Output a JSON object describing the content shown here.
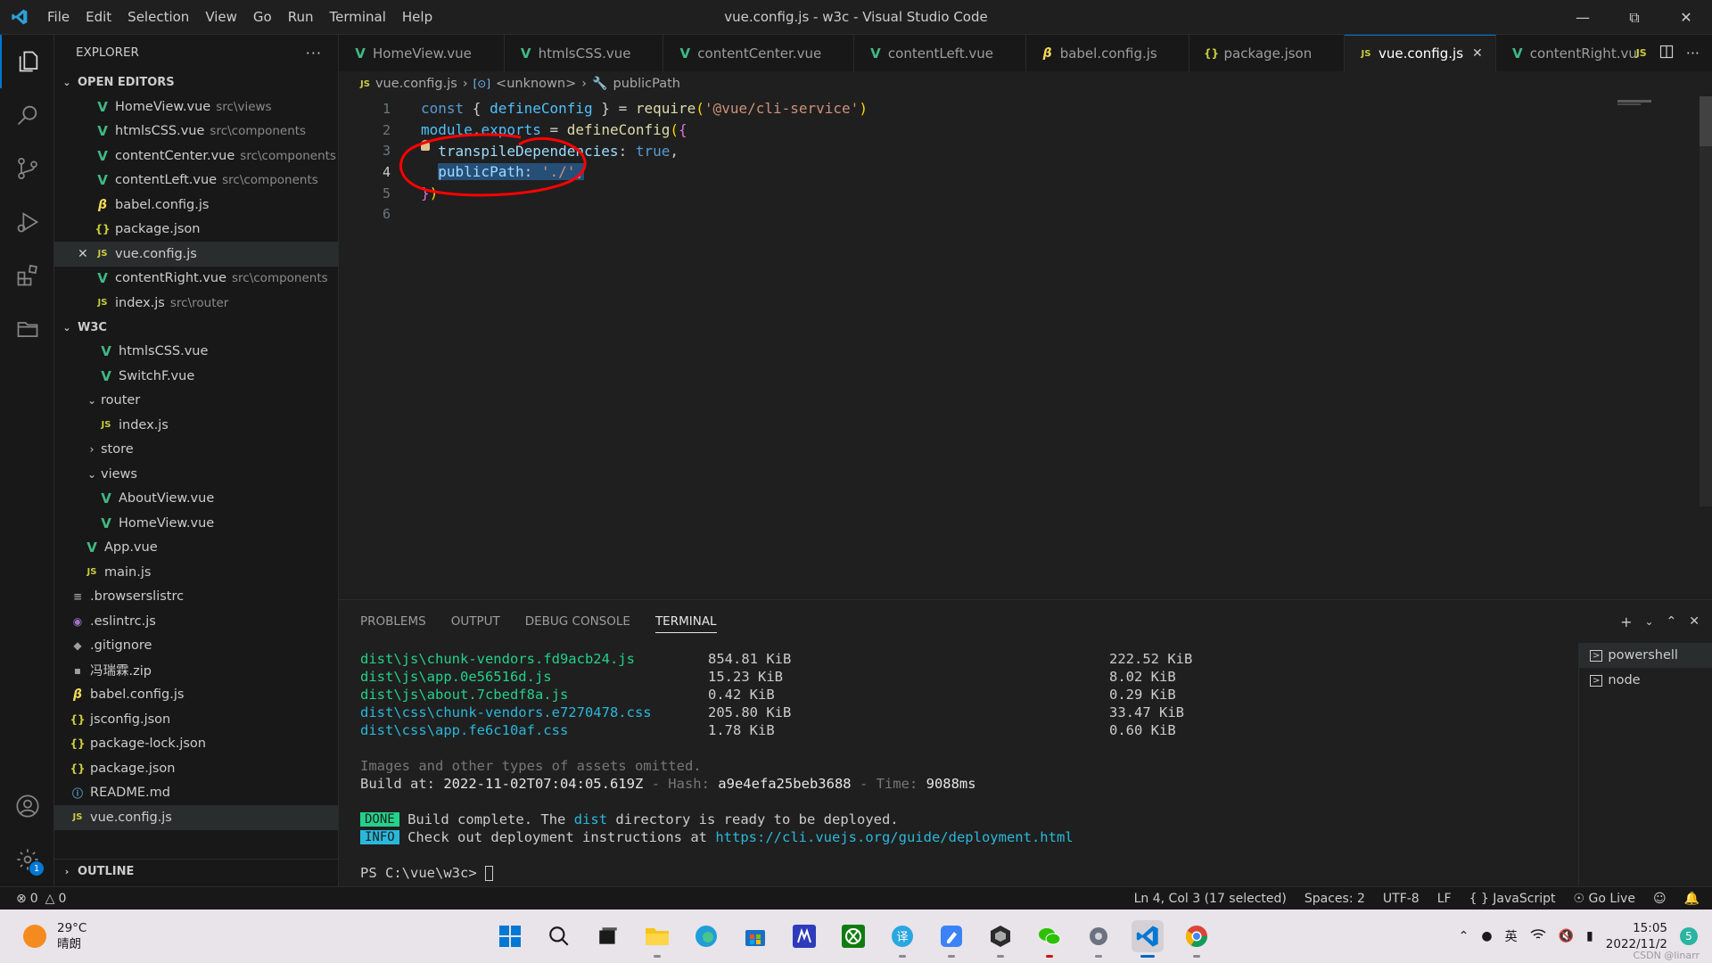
{
  "window": {
    "title": "vue.config.js - w3c - Visual Studio Code"
  },
  "menu": [
    "File",
    "Edit",
    "Selection",
    "View",
    "Go",
    "Run",
    "Terminal",
    "Help"
  ],
  "sidebar": {
    "title": "EXPLORER",
    "open_editors_label": "OPEN EDITORS",
    "open_editors": [
      {
        "name": "HomeView.vue",
        "desc": "src\\views",
        "icon": "vue"
      },
      {
        "name": "htmlsCSS.vue",
        "desc": "src\\components",
        "icon": "vue"
      },
      {
        "name": "contentCenter.vue",
        "desc": "src\\components",
        "icon": "vue"
      },
      {
        "name": "contentLeft.vue",
        "desc": "src\\components",
        "icon": "vue"
      },
      {
        "name": "babel.config.js",
        "desc": "",
        "icon": "babel"
      },
      {
        "name": "package.json",
        "desc": "",
        "icon": "json"
      },
      {
        "name": "vue.config.js",
        "desc": "",
        "icon": "js"
      },
      {
        "name": "contentRight.vue",
        "desc": "src\\components",
        "icon": "vue"
      },
      {
        "name": "index.js",
        "desc": "src\\router",
        "icon": "js"
      }
    ],
    "project_label": "W3C",
    "tree": [
      {
        "name": "htmlsCSS.vue",
        "icon": "vue",
        "indent": 2
      },
      {
        "name": "SwitchF.vue",
        "icon": "vue",
        "indent": 2
      },
      {
        "name": "router",
        "icon": "folder-open",
        "indent": 1
      },
      {
        "name": "index.js",
        "icon": "js",
        "indent": 2
      },
      {
        "name": "store",
        "icon": "folder-closed",
        "indent": 1
      },
      {
        "name": "views",
        "icon": "folder-open",
        "indent": 1
      },
      {
        "name": "AboutView.vue",
        "icon": "vue",
        "indent": 2
      },
      {
        "name": "HomeView.vue",
        "icon": "vue",
        "indent": 2
      },
      {
        "name": "App.vue",
        "icon": "vue",
        "indent": 1
      },
      {
        "name": "main.js",
        "icon": "js",
        "indent": 1
      },
      {
        "name": ".browserslistrc",
        "icon": "list",
        "indent": 0
      },
      {
        "name": ".eslintrc.js",
        "icon": "eslint",
        "indent": 0
      },
      {
        "name": ".gitignore",
        "icon": "git",
        "indent": 0
      },
      {
        "name": "冯瑞霖.zip",
        "icon": "zip",
        "indent": 0
      },
      {
        "name": "babel.config.js",
        "icon": "babel",
        "indent": 0
      },
      {
        "name": "jsconfig.json",
        "icon": "json",
        "indent": 0
      },
      {
        "name": "package-lock.json",
        "icon": "json",
        "indent": 0
      },
      {
        "name": "package.json",
        "icon": "json",
        "indent": 0
      },
      {
        "name": "README.md",
        "icon": "info",
        "indent": 0
      },
      {
        "name": "vue.config.js",
        "icon": "js",
        "indent": 0
      }
    ],
    "outline_label": "OUTLINE"
  },
  "tabs": [
    {
      "label": "HomeView.vue",
      "icon": "vue"
    },
    {
      "label": "htmlsCSS.vue",
      "icon": "vue"
    },
    {
      "label": "contentCenter.vue",
      "icon": "vue"
    },
    {
      "label": "contentLeft.vue",
      "icon": "vue"
    },
    {
      "label": "babel.config.js",
      "icon": "babel"
    },
    {
      "label": "package.json",
      "icon": "json"
    },
    {
      "label": "vue.config.js",
      "icon": "js",
      "active": true
    },
    {
      "label": "contentRight.vue",
      "icon": "vue"
    }
  ],
  "breadcrumb": {
    "file": "vue.config.js",
    "unknown": "<unknown>",
    "symbol": "publicPath"
  },
  "editor": {
    "lines": [
      "1",
      "2",
      "3",
      "4",
      "5",
      "6"
    ],
    "line1": {
      "a": "const",
      "b": " { ",
      "c": "defineConfig",
      "d": " } = ",
      "e": "require",
      "f": "(",
      "g": "'@vue/cli-service'",
      "h": ")"
    },
    "line2": {
      "a": "module",
      "b": ".",
      "c": "exports",
      "d": " = ",
      "e": "defineConfig",
      "f": "(",
      "g": "{"
    },
    "line3": {
      "a": "  transpileDependencies",
      "b": ": ",
      "c": "true",
      "d": ","
    },
    "line4": {
      "a": "  ",
      "b": "publicPath",
      "c": ": ",
      "d": "'./'",
      "e": ","
    },
    "line5": {
      "a": "}",
      "b": ")"
    }
  },
  "panel": {
    "tabs": [
      "PROBLEMS",
      "OUTPUT",
      "DEBUG CONSOLE",
      "TERMINAL"
    ],
    "files": [
      {
        "path": "dist\\js\\chunk-vendors.fd9acb24.js",
        "size": "854.81 KiB",
        "gzip": "222.52 KiB",
        "type": "js"
      },
      {
        "path": "dist\\js\\app.0e56516d.js",
        "size": "15.23 KiB",
        "gzip": "8.02 KiB",
        "type": "js"
      },
      {
        "path": "dist\\js\\about.7cbedf8a.js",
        "size": "0.42 KiB",
        "gzip": "0.29 KiB",
        "type": "js"
      },
      {
        "path": "dist\\css\\chunk-vendors.e7270478.css",
        "size": "205.80 KiB",
        "gzip": "33.47 KiB",
        "type": "css"
      },
      {
        "path": "dist\\css\\app.fe6c10af.css",
        "size": "1.78 KiB",
        "gzip": "0.60 KiB",
        "type": "css"
      }
    ],
    "omitted": "Images and other types of assets omitted.",
    "build_prefix": "Build at: ",
    "build_time": "2022-11-02T07:04:05.619Z",
    "hash_sep": " - Hash: ",
    "hash": "a9e4efa25beb3688",
    "time_sep": " - Time: ",
    "time": "9088ms",
    "done_tag": "DONE",
    "done_a": "Build complete. The ",
    "done_b": "dist",
    "done_c": " directory is ready to be deployed.",
    "info_tag": "INFO",
    "info_a": "Check out deployment instructions at ",
    "info_url": "https://cli.vuejs.org/guide/deployment.html",
    "prompt": "PS C:\\vue\\w3c> ",
    "terminals": [
      "powershell",
      "node"
    ]
  },
  "status": {
    "errors": "0",
    "warnings": "0",
    "position": "Ln 4, Col 3 (17 selected)",
    "spaces": "Spaces: 2",
    "encoding": "UTF-8",
    "eol": "LF",
    "language": "JavaScript",
    "golive": "Go Live"
  },
  "taskbar": {
    "temp": "29°C",
    "weather": "晴朗",
    "ime": "英",
    "time": "15:05",
    "date": "2022/11/2",
    "notifications": "5",
    "watermark": "CSDN @linarr"
  },
  "colors": {
    "accent": "#0078d4",
    "vue": "#41b883",
    "js": "#cbcb41",
    "annotation": "#ff0000"
  }
}
